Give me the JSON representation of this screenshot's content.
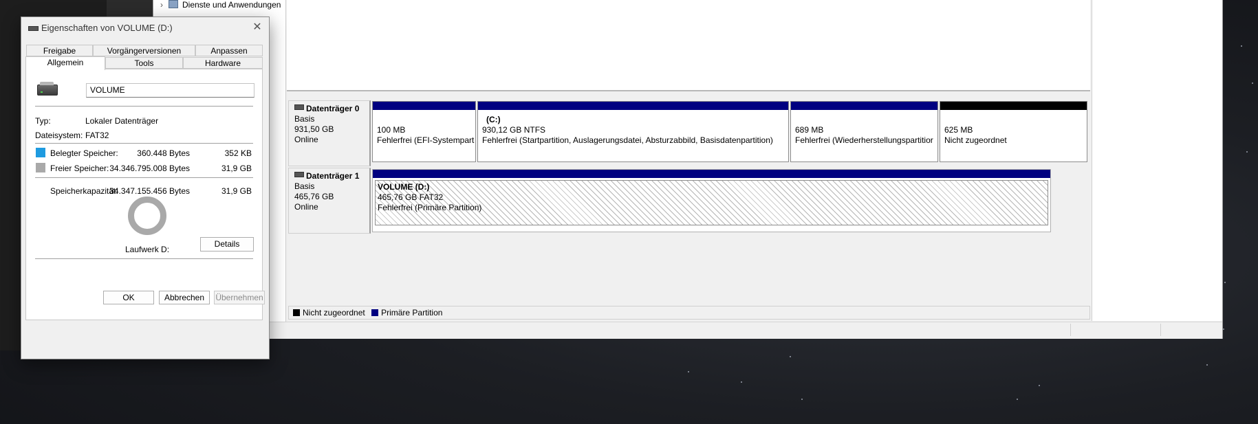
{
  "tree": {
    "item_label": "Dienste und Anwendungen"
  },
  "disks": [
    {
      "name": "Datenträger 0",
      "type": "Basis",
      "size": "931,50 GB",
      "status": "Online",
      "partitions": [
        {
          "label": "",
          "size": "100 MB",
          "status": "Fehlerfrei (EFI-Systempart",
          "bar": "primary"
        },
        {
          "label": "(C:)",
          "size": "930,12 GB NTFS",
          "status": "Fehlerfrei (Startpartition, Auslagerungsdatei, Absturzabbild, Basisdatenpartition)",
          "bar": "primary"
        },
        {
          "label": "",
          "size": "689 MB",
          "status": "Fehlerfrei (Wiederherstellungspartitior",
          "bar": "primary"
        },
        {
          "label": "",
          "size": "625 MB",
          "status": "Nicht zugeordnet",
          "bar": "unallocated"
        }
      ]
    },
    {
      "name": "Datenträger 1",
      "type": "Basis",
      "size": "465,76 GB",
      "status": "Online",
      "partitions": [
        {
          "label": "VOLUME  (D:)",
          "size": "465,76 GB FAT32",
          "status": "Fehlerfrei (Primäre Partition)",
          "bar": "primary"
        }
      ]
    }
  ],
  "legend": {
    "unallocated": "Nicht zugeordnet",
    "primary": "Primäre Partition"
  },
  "colors": {
    "primary": "#000080",
    "unallocated": "#000000",
    "used": "#1e9be0",
    "free": "#a9a9a9"
  },
  "dialog": {
    "title": "Eigenschaften von VOLUME (D:)",
    "tabs_row1": [
      "Freigabe",
      "Vorgängerversionen",
      "Anpassen"
    ],
    "tabs_row2": [
      "Allgemein",
      "Tools",
      "Hardware"
    ],
    "active_tab": "Allgemein",
    "volume_name": "VOLUME",
    "type_label": "Typ:",
    "type_value": "Lokaler Datenträger",
    "fs_label": "Dateisystem:",
    "fs_value": "FAT32",
    "used_label": "Belegter Speicher:",
    "used_bytes": "360.448 Bytes",
    "used_size": "352 KB",
    "free_label": "Freier Speicher:",
    "free_bytes": "34.346.795.008 Bytes",
    "free_size": "31,9 GB",
    "cap_label": "Speicherkapazität:",
    "cap_bytes": "34.347.155.456 Bytes",
    "cap_size": "31,9 GB",
    "drive_label": "Laufwerk D:",
    "details_button": "Details",
    "ok_button": "OK",
    "cancel_button": "Abbrechen",
    "apply_button": "Übernehmen",
    "used_fraction": 1e-05
  }
}
